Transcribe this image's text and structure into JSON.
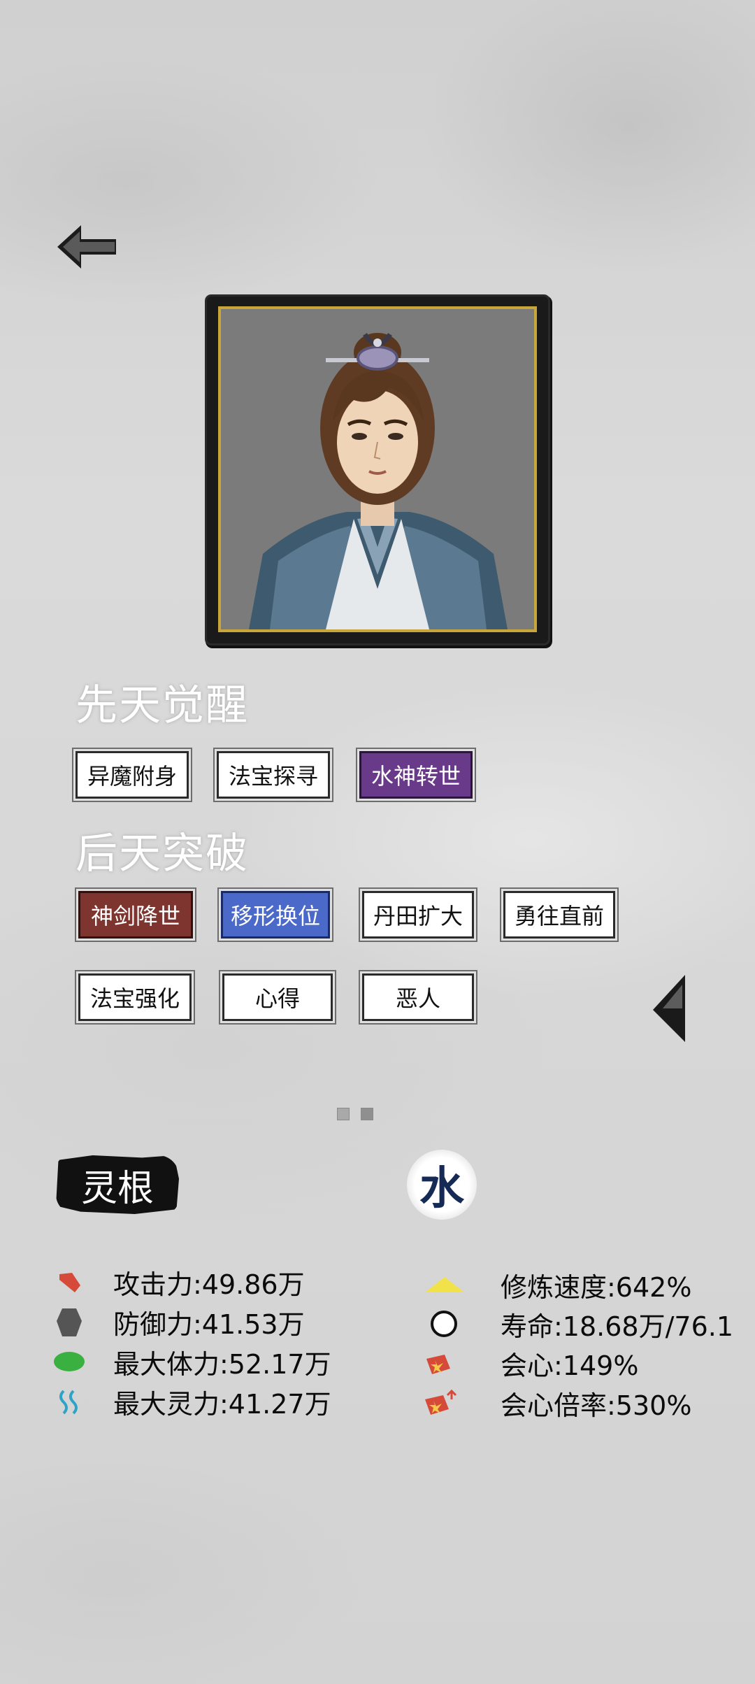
{
  "nav": {
    "back_icon": "back-arrow-icon",
    "next_icon": "triangle-left-icon"
  },
  "innate": {
    "title": "先天觉醒",
    "chips": [
      {
        "label": "异魔附身",
        "style": "white"
      },
      {
        "label": "法宝探寻",
        "style": "white"
      },
      {
        "label": "水神转世",
        "style": "purple"
      }
    ]
  },
  "acquired": {
    "title": "后天突破",
    "chips": [
      {
        "label": "神剑降世",
        "style": "red"
      },
      {
        "label": "移形换位",
        "style": "blue"
      },
      {
        "label": "丹田扩大",
        "style": "white"
      },
      {
        "label": "勇往直前",
        "style": "white"
      },
      {
        "label": "法宝强化",
        "style": "white"
      },
      {
        "label": "心得",
        "style": "white"
      },
      {
        "label": "恶人",
        "style": "white"
      }
    ]
  },
  "pager": {
    "pages": 2
  },
  "root": {
    "label": "灵根",
    "element": "水"
  },
  "stats": {
    "left": [
      {
        "text": "攻击力:49.86万",
        "icon": "attack-icon",
        "color": "#d64a3a"
      },
      {
        "text": "防御力:41.53万",
        "icon": "defense-icon",
        "color": "#555555"
      },
      {
        "text": "最大体力:52.17万",
        "icon": "stamina-icon",
        "color": "#39b03f"
      },
      {
        "text": "最大灵力:41.27万",
        "icon": "spirit-icon",
        "color": "#2ea3c8"
      }
    ],
    "right": [
      {
        "text": "修炼速度:642%",
        "icon": "cultivation-speed-icon",
        "color": "#f2e24a"
      },
      {
        "text": "寿命:18.68万/76.1",
        "icon": "lifespan-icon",
        "color": "#111111"
      },
      {
        "text": "会心:149%",
        "icon": "critical-icon",
        "color": "#d64a3a"
      },
      {
        "text": "会心倍率:530%",
        "icon": "critical-multiplier-icon",
        "color": "#d64a3a"
      }
    ]
  }
}
